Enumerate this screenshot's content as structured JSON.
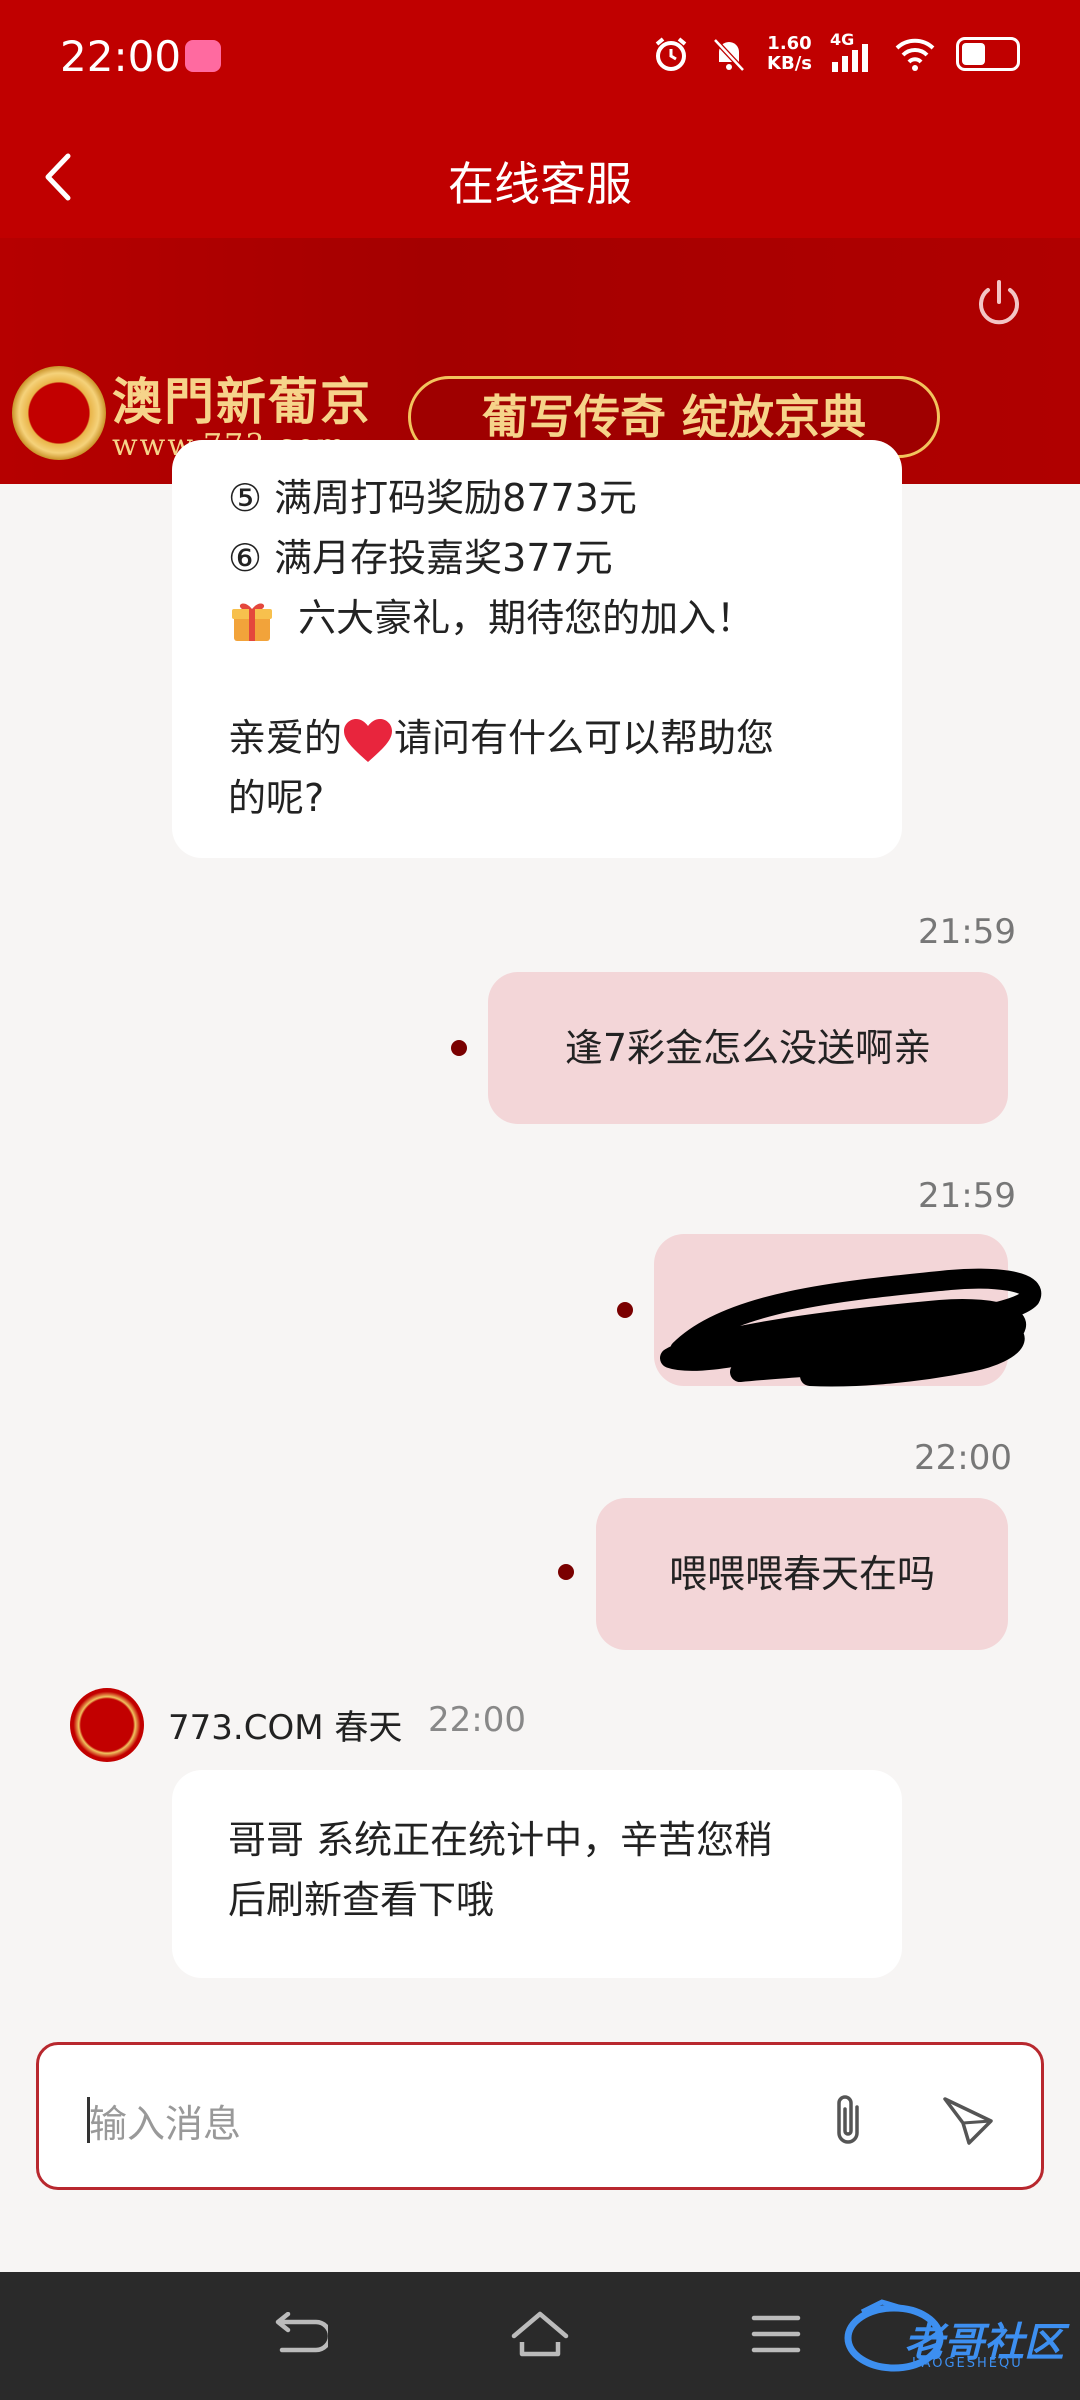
{
  "status_bar": {
    "time": "22:00",
    "net_speed_value": "1.60",
    "net_speed_unit": "KB/s",
    "network": "4G",
    "battery_level": 0.45
  },
  "header": {
    "title": "在线客服"
  },
  "banner": {
    "brand_name": "澳門新葡京",
    "brand_url": "www.773.com",
    "slogan": "葡写传奇 绽放京典"
  },
  "messages": {
    "first": {
      "line1": "⑤ 满周打码奖励8773元",
      "line2": "⑥ 满月存投嘉奖377元",
      "line3": "六大豪礼，期待您的加入！",
      "line4_before": "亲爱的",
      "line4_after": "请问有什么可以帮助您",
      "line5": "的呢?"
    },
    "out1": {
      "time": "21:59",
      "text": "逢7彩金怎么没送啊亲"
    },
    "out2": {
      "time": "21:59",
      "text": ""
    },
    "out3": {
      "time": "22:00",
      "text": "喂喂喂春天在吗"
    },
    "reply": {
      "sender": "773.COM 春天",
      "time": "22:00",
      "line1": "哥哥 系统正在统计中，辛苦您稍",
      "line2": "后刷新查看下哦"
    }
  },
  "composer": {
    "placeholder": "输入消息"
  },
  "watermark": {
    "text": "老哥社区",
    "sub": "LAOGESHEQU"
  },
  "colors": {
    "header_red": "#c00000",
    "outgoing_bubble": "#f3d6d8",
    "incoming_bubble": "#ffffff",
    "gold": "#f6d48a"
  }
}
